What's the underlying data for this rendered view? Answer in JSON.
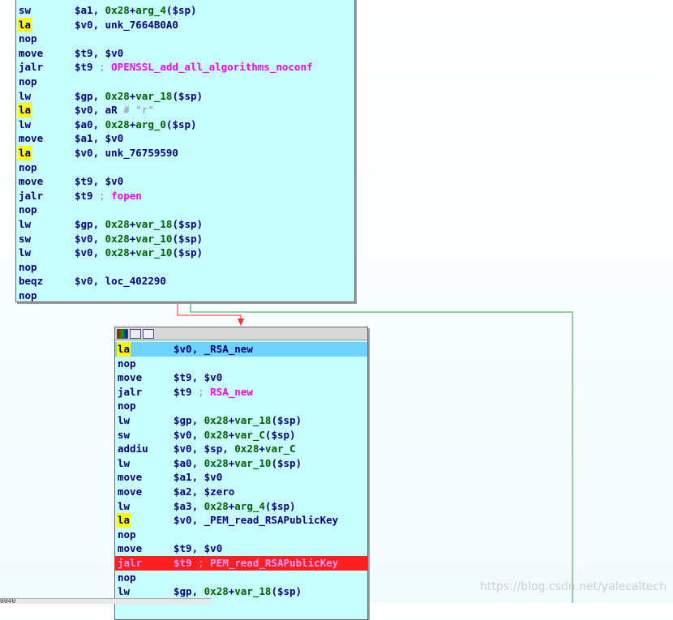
{
  "node1": {
    "rows": [
      {
        "mn": "sw",
        "ops": [
          [
            "reg",
            "$a1"
          ],
          [
            "t",
            ", "
          ],
          [
            "num",
            "0x28"
          ],
          [
            "t",
            "+"
          ],
          [
            "num",
            "arg_4"
          ],
          [
            "t",
            "("
          ],
          [
            "reg",
            "$sp"
          ],
          [
            "t",
            ")"
          ]
        ]
      },
      {
        "mn": "la",
        "hl": true,
        "ops": [
          [
            "reg",
            "$v0"
          ],
          [
            "t",
            ", "
          ],
          [
            "name",
            "unk_7664B0A0"
          ]
        ]
      },
      {
        "mn": "nop",
        "ops": []
      },
      {
        "mn": "move",
        "ops": [
          [
            "reg",
            "$t9"
          ],
          [
            "t",
            ", "
          ],
          [
            "reg",
            "$v0"
          ]
        ]
      },
      {
        "mn": "jalr",
        "ops": [
          [
            "reg",
            "$t9"
          ],
          [
            "cmt",
            " ; "
          ],
          [
            "fn",
            "OPENSSL_add_all_algorithms_noconf"
          ]
        ]
      },
      {
        "mn": "nop",
        "ops": []
      },
      {
        "mn": "lw",
        "ops": [
          [
            "reg",
            "$gp"
          ],
          [
            "t",
            ", "
          ],
          [
            "num",
            "0x28"
          ],
          [
            "t",
            "+"
          ],
          [
            "num",
            "var_18"
          ],
          [
            "t",
            "("
          ],
          [
            "reg",
            "$sp"
          ],
          [
            "t",
            ")"
          ]
        ]
      },
      {
        "mn": "la",
        "hl": true,
        "ops": [
          [
            "reg",
            "$v0"
          ],
          [
            "t",
            ", "
          ],
          [
            "name",
            "aR"
          ],
          [
            "cmt",
            "           # \"r\""
          ]
        ]
      },
      {
        "mn": "lw",
        "ops": [
          [
            "reg",
            "$a0"
          ],
          [
            "t",
            ", "
          ],
          [
            "num",
            "0x28"
          ],
          [
            "t",
            "+"
          ],
          [
            "num",
            "arg_0"
          ],
          [
            "t",
            "("
          ],
          [
            "reg",
            "$sp"
          ],
          [
            "t",
            ")"
          ]
        ]
      },
      {
        "mn": "move",
        "ops": [
          [
            "reg",
            "$a1"
          ],
          [
            "t",
            ", "
          ],
          [
            "reg",
            "$v0"
          ]
        ]
      },
      {
        "mn": "la",
        "hl": true,
        "ops": [
          [
            "reg",
            "$v0"
          ],
          [
            "t",
            ", "
          ],
          [
            "name",
            "unk_76759590"
          ]
        ]
      },
      {
        "mn": "nop",
        "ops": []
      },
      {
        "mn": "move",
        "ops": [
          [
            "reg",
            "$t9"
          ],
          [
            "t",
            ", "
          ],
          [
            "reg",
            "$v0"
          ]
        ]
      },
      {
        "mn": "jalr",
        "ops": [
          [
            "reg",
            "$t9"
          ],
          [
            "cmt",
            " ; "
          ],
          [
            "fn",
            "fopen"
          ]
        ]
      },
      {
        "mn": "nop",
        "ops": []
      },
      {
        "mn": "lw",
        "ops": [
          [
            "reg",
            "$gp"
          ],
          [
            "t",
            ", "
          ],
          [
            "num",
            "0x28"
          ],
          [
            "t",
            "+"
          ],
          [
            "num",
            "var_18"
          ],
          [
            "t",
            "("
          ],
          [
            "reg",
            "$sp"
          ],
          [
            "t",
            ")"
          ]
        ]
      },
      {
        "mn": "sw",
        "ops": [
          [
            "reg",
            "$v0"
          ],
          [
            "t",
            ", "
          ],
          [
            "num",
            "0x28"
          ],
          [
            "t",
            "+"
          ],
          [
            "num",
            "var_10"
          ],
          [
            "t",
            "("
          ],
          [
            "reg",
            "$sp"
          ],
          [
            "t",
            ")"
          ]
        ]
      },
      {
        "mn": "lw",
        "ops": [
          [
            "reg",
            "$v0"
          ],
          [
            "t",
            ", "
          ],
          [
            "num",
            "0x28"
          ],
          [
            "t",
            "+"
          ],
          [
            "num",
            "var_10"
          ],
          [
            "t",
            "("
          ],
          [
            "reg",
            "$sp"
          ],
          [
            "t",
            ")"
          ]
        ]
      },
      {
        "mn": "nop",
        "ops": []
      },
      {
        "mn": "beqz",
        "ops": [
          [
            "reg",
            "$v0"
          ],
          [
            "t",
            ", "
          ],
          [
            "name",
            "loc_402290"
          ]
        ]
      },
      {
        "mn": "nop",
        "ops": []
      }
    ]
  },
  "node2": {
    "rows": [
      {
        "mn": "la",
        "hl": true,
        "sel": true,
        "ops": [
          [
            "reg",
            "$v0"
          ],
          [
            "t",
            ", "
          ],
          [
            "name",
            "_RSA_new"
          ]
        ]
      },
      {
        "mn": "nop",
        "ops": []
      },
      {
        "mn": "move",
        "ops": [
          [
            "reg",
            "$t9"
          ],
          [
            "t",
            ", "
          ],
          [
            "reg",
            "$v0"
          ]
        ]
      },
      {
        "mn": "jalr",
        "ops": [
          [
            "reg",
            "$t9"
          ],
          [
            "cmt",
            " ; "
          ],
          [
            "fn",
            "RSA_new"
          ]
        ]
      },
      {
        "mn": "nop",
        "ops": []
      },
      {
        "mn": "lw",
        "ops": [
          [
            "reg",
            "$gp"
          ],
          [
            "t",
            ", "
          ],
          [
            "num",
            "0x28"
          ],
          [
            "t",
            "+"
          ],
          [
            "num",
            "var_18"
          ],
          [
            "t",
            "("
          ],
          [
            "reg",
            "$sp"
          ],
          [
            "t",
            ")"
          ]
        ]
      },
      {
        "mn": "sw",
        "ops": [
          [
            "reg",
            "$v0"
          ],
          [
            "t",
            ", "
          ],
          [
            "num",
            "0x28"
          ],
          [
            "t",
            "+"
          ],
          [
            "num",
            "var_C"
          ],
          [
            "t",
            "("
          ],
          [
            "reg",
            "$sp"
          ],
          [
            "t",
            ")"
          ]
        ]
      },
      {
        "mn": "addiu",
        "ops": [
          [
            "reg",
            "$v0"
          ],
          [
            "t",
            ", "
          ],
          [
            "reg",
            "$sp"
          ],
          [
            "t",
            ", "
          ],
          [
            "num",
            "0x28"
          ],
          [
            "t",
            "+"
          ],
          [
            "num",
            "var_C"
          ]
        ]
      },
      {
        "mn": "lw",
        "ops": [
          [
            "reg",
            "$a0"
          ],
          [
            "t",
            ", "
          ],
          [
            "num",
            "0x28"
          ],
          [
            "t",
            "+"
          ],
          [
            "num",
            "var_10"
          ],
          [
            "t",
            "("
          ],
          [
            "reg",
            "$sp"
          ],
          [
            "t",
            ")"
          ]
        ]
      },
      {
        "mn": "move",
        "ops": [
          [
            "reg",
            "$a1"
          ],
          [
            "t",
            ", "
          ],
          [
            "reg",
            "$v0"
          ]
        ]
      },
      {
        "mn": "move",
        "ops": [
          [
            "reg",
            "$a2"
          ],
          [
            "t",
            ", "
          ],
          [
            "reg",
            "$zero"
          ]
        ]
      },
      {
        "mn": "lw",
        "ops": [
          [
            "reg",
            "$a3"
          ],
          [
            "t",
            ", "
          ],
          [
            "num",
            "0x28"
          ],
          [
            "t",
            "+"
          ],
          [
            "num",
            "arg_4"
          ],
          [
            "t",
            "("
          ],
          [
            "reg",
            "$sp"
          ],
          [
            "t",
            ")"
          ]
        ]
      },
      {
        "mn": "la",
        "hl": true,
        "ops": [
          [
            "reg",
            "$v0"
          ],
          [
            "t",
            ", "
          ],
          [
            "name",
            "_PEM_read_RSAPublicKey"
          ]
        ]
      },
      {
        "mn": "nop",
        "ops": []
      },
      {
        "mn": "move",
        "ops": [
          [
            "reg",
            "$t9"
          ],
          [
            "t",
            ", "
          ],
          [
            "reg",
            "$v0"
          ]
        ]
      },
      {
        "mn": "jalr",
        "bp": true,
        "ops": [
          [
            "reg",
            "$t9"
          ],
          [
            "cmt",
            " ; "
          ],
          [
            "fn",
            "PEM_read_RSAPublicKey"
          ]
        ]
      },
      {
        "mn": "nop",
        "ops": []
      },
      {
        "mn": "lw",
        "ops": [
          [
            "reg",
            "$gp"
          ],
          [
            "t",
            ", "
          ],
          [
            "num",
            "0x28"
          ],
          [
            "t",
            "+"
          ],
          [
            "num",
            "var_18"
          ],
          [
            "t",
            "("
          ],
          [
            "reg",
            "$sp"
          ],
          [
            "t",
            ")"
          ]
        ]
      }
    ]
  },
  "status_text": "0040",
  "watermark": "https://blog.csdn.net/yalecaltech",
  "colors": {
    "node_bg": "#c7ffff",
    "selected": "#6fd3ff",
    "breakpoint": "#ff2020",
    "highlight": "#ffff00",
    "edge_red": "#ff3030",
    "edge_green": "#22aa44"
  }
}
